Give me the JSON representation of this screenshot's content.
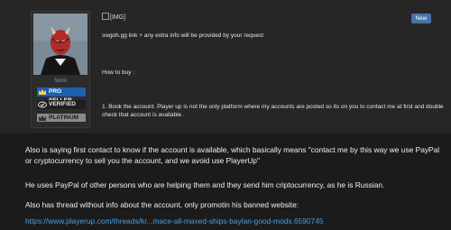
{
  "post": {
    "user": {
      "name": "Sorvi",
      "badges": [
        "PRO SELLER",
        "VERIFIED",
        "PLATINUM"
      ]
    },
    "image_alt": "[IMG]",
    "new_label": "New",
    "lines": [
      "swgoh.gg link + any extra info will be provided by your request",
      "How to buy :",
      "1. Book the account. Player up is not the only platform where my accounts are posted so its on you to contact me at first and double check that account is available ."
    ]
  },
  "comment": {
    "paragraphs": [
      "Also is saying first contact to know if the account is available, which basically means \"contact me by this way we use PayPal or cryptocurrency to sell you the account, and we avoid use PlayerUp\"",
      "He uses PayPal of other persons who are helping them and they send him criptocurrency, as he is Russian.",
      "Also has thread without info about the account, only promotin his banned website:"
    ],
    "link": "https://www.playerup.com/threads/kr...mace-all-maxed-ships-baylan-good-mods.6590745"
  },
  "colors": {
    "page_bg": "#1b1b1b",
    "post_bg": "#262626",
    "link": "#4a9fe0",
    "pro_seller": "#1d5fb0",
    "new_badge": "#4a73a8"
  }
}
